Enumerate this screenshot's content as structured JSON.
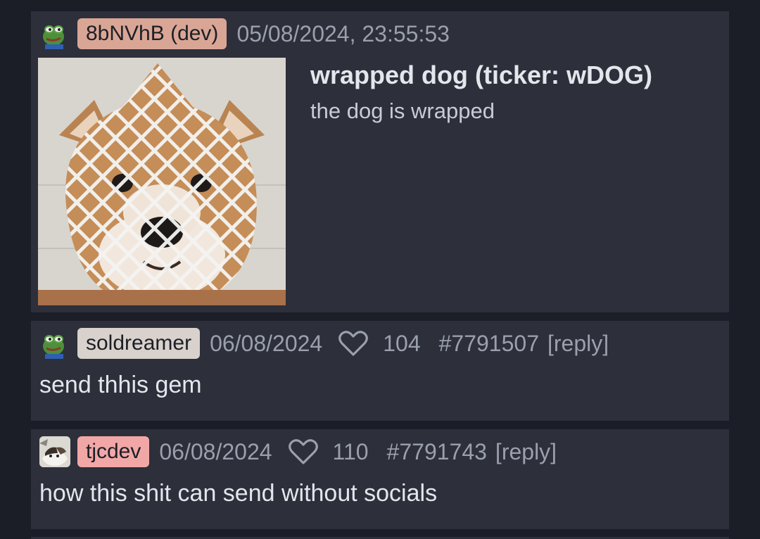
{
  "thread": {
    "op": {
      "author": "8bNVhB (dev)",
      "author_color": "#d9a696",
      "timestamp": "05/08/2024, 23:55:53",
      "avatar_icon": "pepe-frog-icon",
      "image_alt": "dog wrapped in white fruit foam net",
      "title": "wrapped dog (ticker: wDOG)",
      "description": "the dog is wrapped"
    },
    "replies": [
      {
        "author": "soldreamer",
        "author_color": "#d8d1cc",
        "avatar_icon": "pepe-frog-icon",
        "date": "06/08/2024",
        "likes": "104",
        "post_number": "#7791507",
        "reply_label": "[reply]",
        "text": "send thhis gem"
      },
      {
        "author": "tjcdev",
        "author_color": "#f2a7a7",
        "avatar_icon": "cat-avatar-icon",
        "date": "06/08/2024",
        "likes": "110",
        "post_number": "#7791743",
        "reply_label": "[reply]",
        "text": "how this shit can send without socials"
      }
    ]
  },
  "colors": {
    "background": "#1c1e27",
    "card": "#2d2f3b",
    "muted_text": "#9aa0ad",
    "primary_text": "#e4e6ec"
  }
}
